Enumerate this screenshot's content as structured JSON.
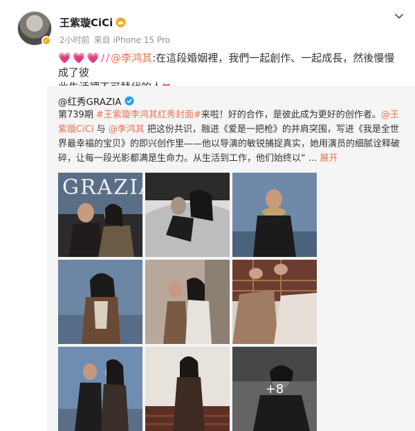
{
  "header": {
    "author_name": "王紫璇CiCi",
    "time": "2小时前",
    "source": "来自 iPhone 15 Pro"
  },
  "post": {
    "hearts": "💗💗💗//",
    "mention": "@李鸿其",
    "text_line1": ":在這段婚姻裡，我們一起創作、一起成長，然後慢慢成了彼",
    "text_line2": "此生活裡不可替代的人",
    "heart_end": "❤"
  },
  "repost": {
    "author": "@红秀GRAZIA",
    "line1_prefix": "第739期",
    "line1_hashtag1": "#王紫璇李鸿其红秀封面#",
    "line1_suffix": "来啦！好的合作，是彼此成为更好的创作者。",
    "line1_mention": "@王",
    "line2_mention": "紫璇CiCi",
    "line2_mid": "与",
    "line2_mention2": "@李鸿其",
    "line2_suffix": "把这份共识，融进《爱是一把枪》的并肩突围，写进《我是全世",
    "line3": "界最幸福的宝贝》的即兴创作里——他以导演的敏锐捕捉真实，她用演员的细腻诠释破",
    "line4": "碎，让每一段光影都满是生命力。从生活到工作，他们始终以“ ...",
    "expand": "展开"
  },
  "grid": {
    "magazine_title": "GRAZIA",
    "more_count": "+8"
  },
  "colors": {
    "accent": "#eb7350",
    "heart": "#f0449a",
    "verified": "#1da1f2"
  },
  "icons": [
    "crown-icon",
    "avatar-badge-icon",
    "chevron-down-icon",
    "verified-icon"
  ]
}
